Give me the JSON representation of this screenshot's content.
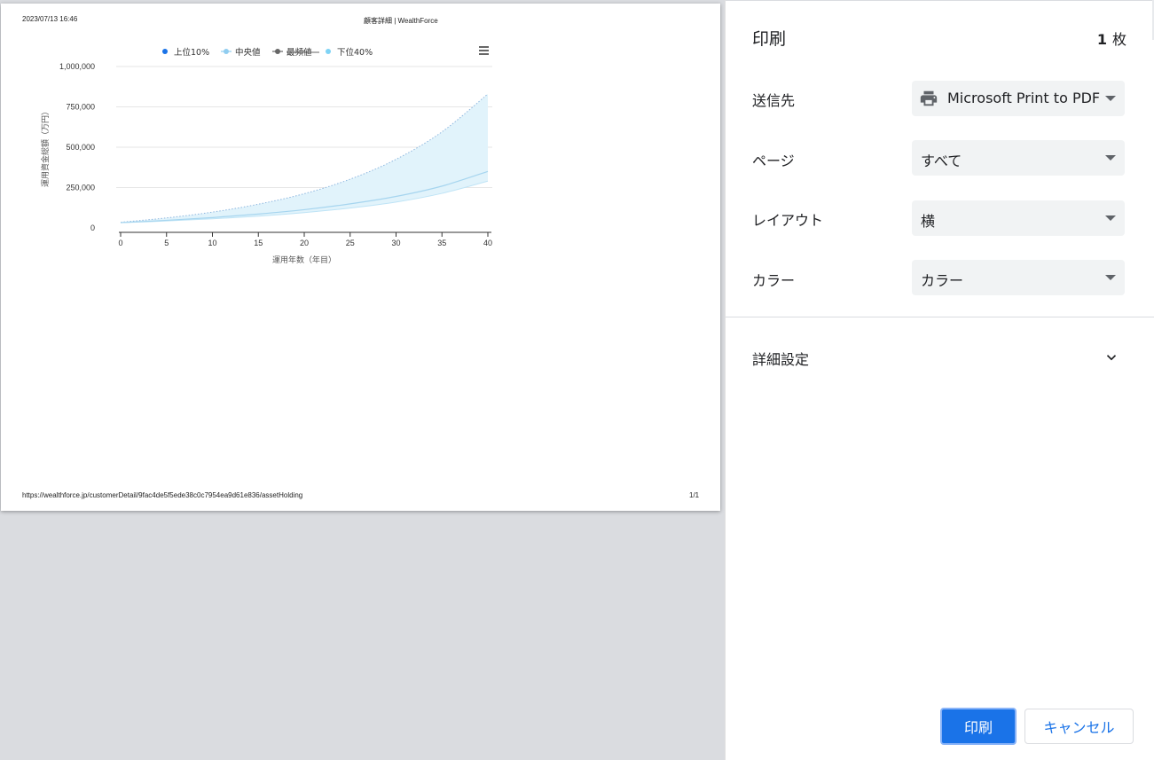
{
  "page": {
    "header_left": "2023/07/13 16:46",
    "header_center": "顧客詳細 | WealthForce",
    "footer_left": "https://wealthforce.jp/customerDetail/9fac4de5f5ede38c0c7954ea9d61e836/assetHolding",
    "footer_right": "1/1"
  },
  "colors": {
    "band_fill": "#e1f3fb",
    "median_line": "#a6d5ef",
    "upper_line": "#8fb7df",
    "lower_line": "#bfe4f6",
    "legend_upper": "#1a73e8",
    "legend_median": "#90cdf0",
    "legend_mode": "#666666",
    "legend_lower": "#7fd3f5",
    "print_button": "#1a73e8"
  },
  "chart_data": {
    "type": "area",
    "xlabel": "運用年数（年目）",
    "ylabel": "運用資金総額（万円）",
    "xlim": [
      0,
      40
    ],
    "ylim": [
      0,
      1000000
    ],
    "x_ticks": [
      0,
      5,
      10,
      15,
      20,
      25,
      30,
      35,
      40
    ],
    "y_ticks": [
      0,
      250000,
      500000,
      750000,
      1000000
    ],
    "y_tick_labels": [
      "0",
      "250,000",
      "500,000",
      "750,000",
      "1,000,000"
    ],
    "grid": true,
    "legend_position": "top",
    "menu_icon": "hamburger-icon",
    "x": [
      0,
      5,
      10,
      15,
      20,
      25,
      30,
      35,
      40
    ],
    "series": [
      {
        "name": "上位10%",
        "values": [
          35000,
          62000,
          98000,
          147000,
          212000,
          302000,
          425000,
          595000,
          830000
        ]
      },
      {
        "name": "中央値",
        "values": [
          33000,
          47000,
          64000,
          86000,
          113000,
          149000,
          195000,
          259000,
          350000
        ]
      },
      {
        "name": "最頻値",
        "values": []
      },
      {
        "name": "下位40%",
        "values": [
          32000,
          43000,
          56000,
          73000,
          95000,
          123000,
          160000,
          214000,
          290000
        ]
      }
    ]
  },
  "panel": {
    "title": "印刷",
    "sheet_count": "1",
    "sheet_unit": "枚",
    "destination_label": "送信先",
    "destination_value": "Microsoft Print to PDF",
    "destination_icon": "printer-icon",
    "pages_label": "ページ",
    "pages_value": "すべて",
    "layout_label": "レイアウト",
    "layout_value": "横",
    "color_label": "カラー",
    "color_value": "カラー",
    "advanced_label": "詳細設定",
    "advanced_icon": "chevron-down-icon",
    "print_button": "印刷",
    "cancel_button": "キャンセル"
  }
}
